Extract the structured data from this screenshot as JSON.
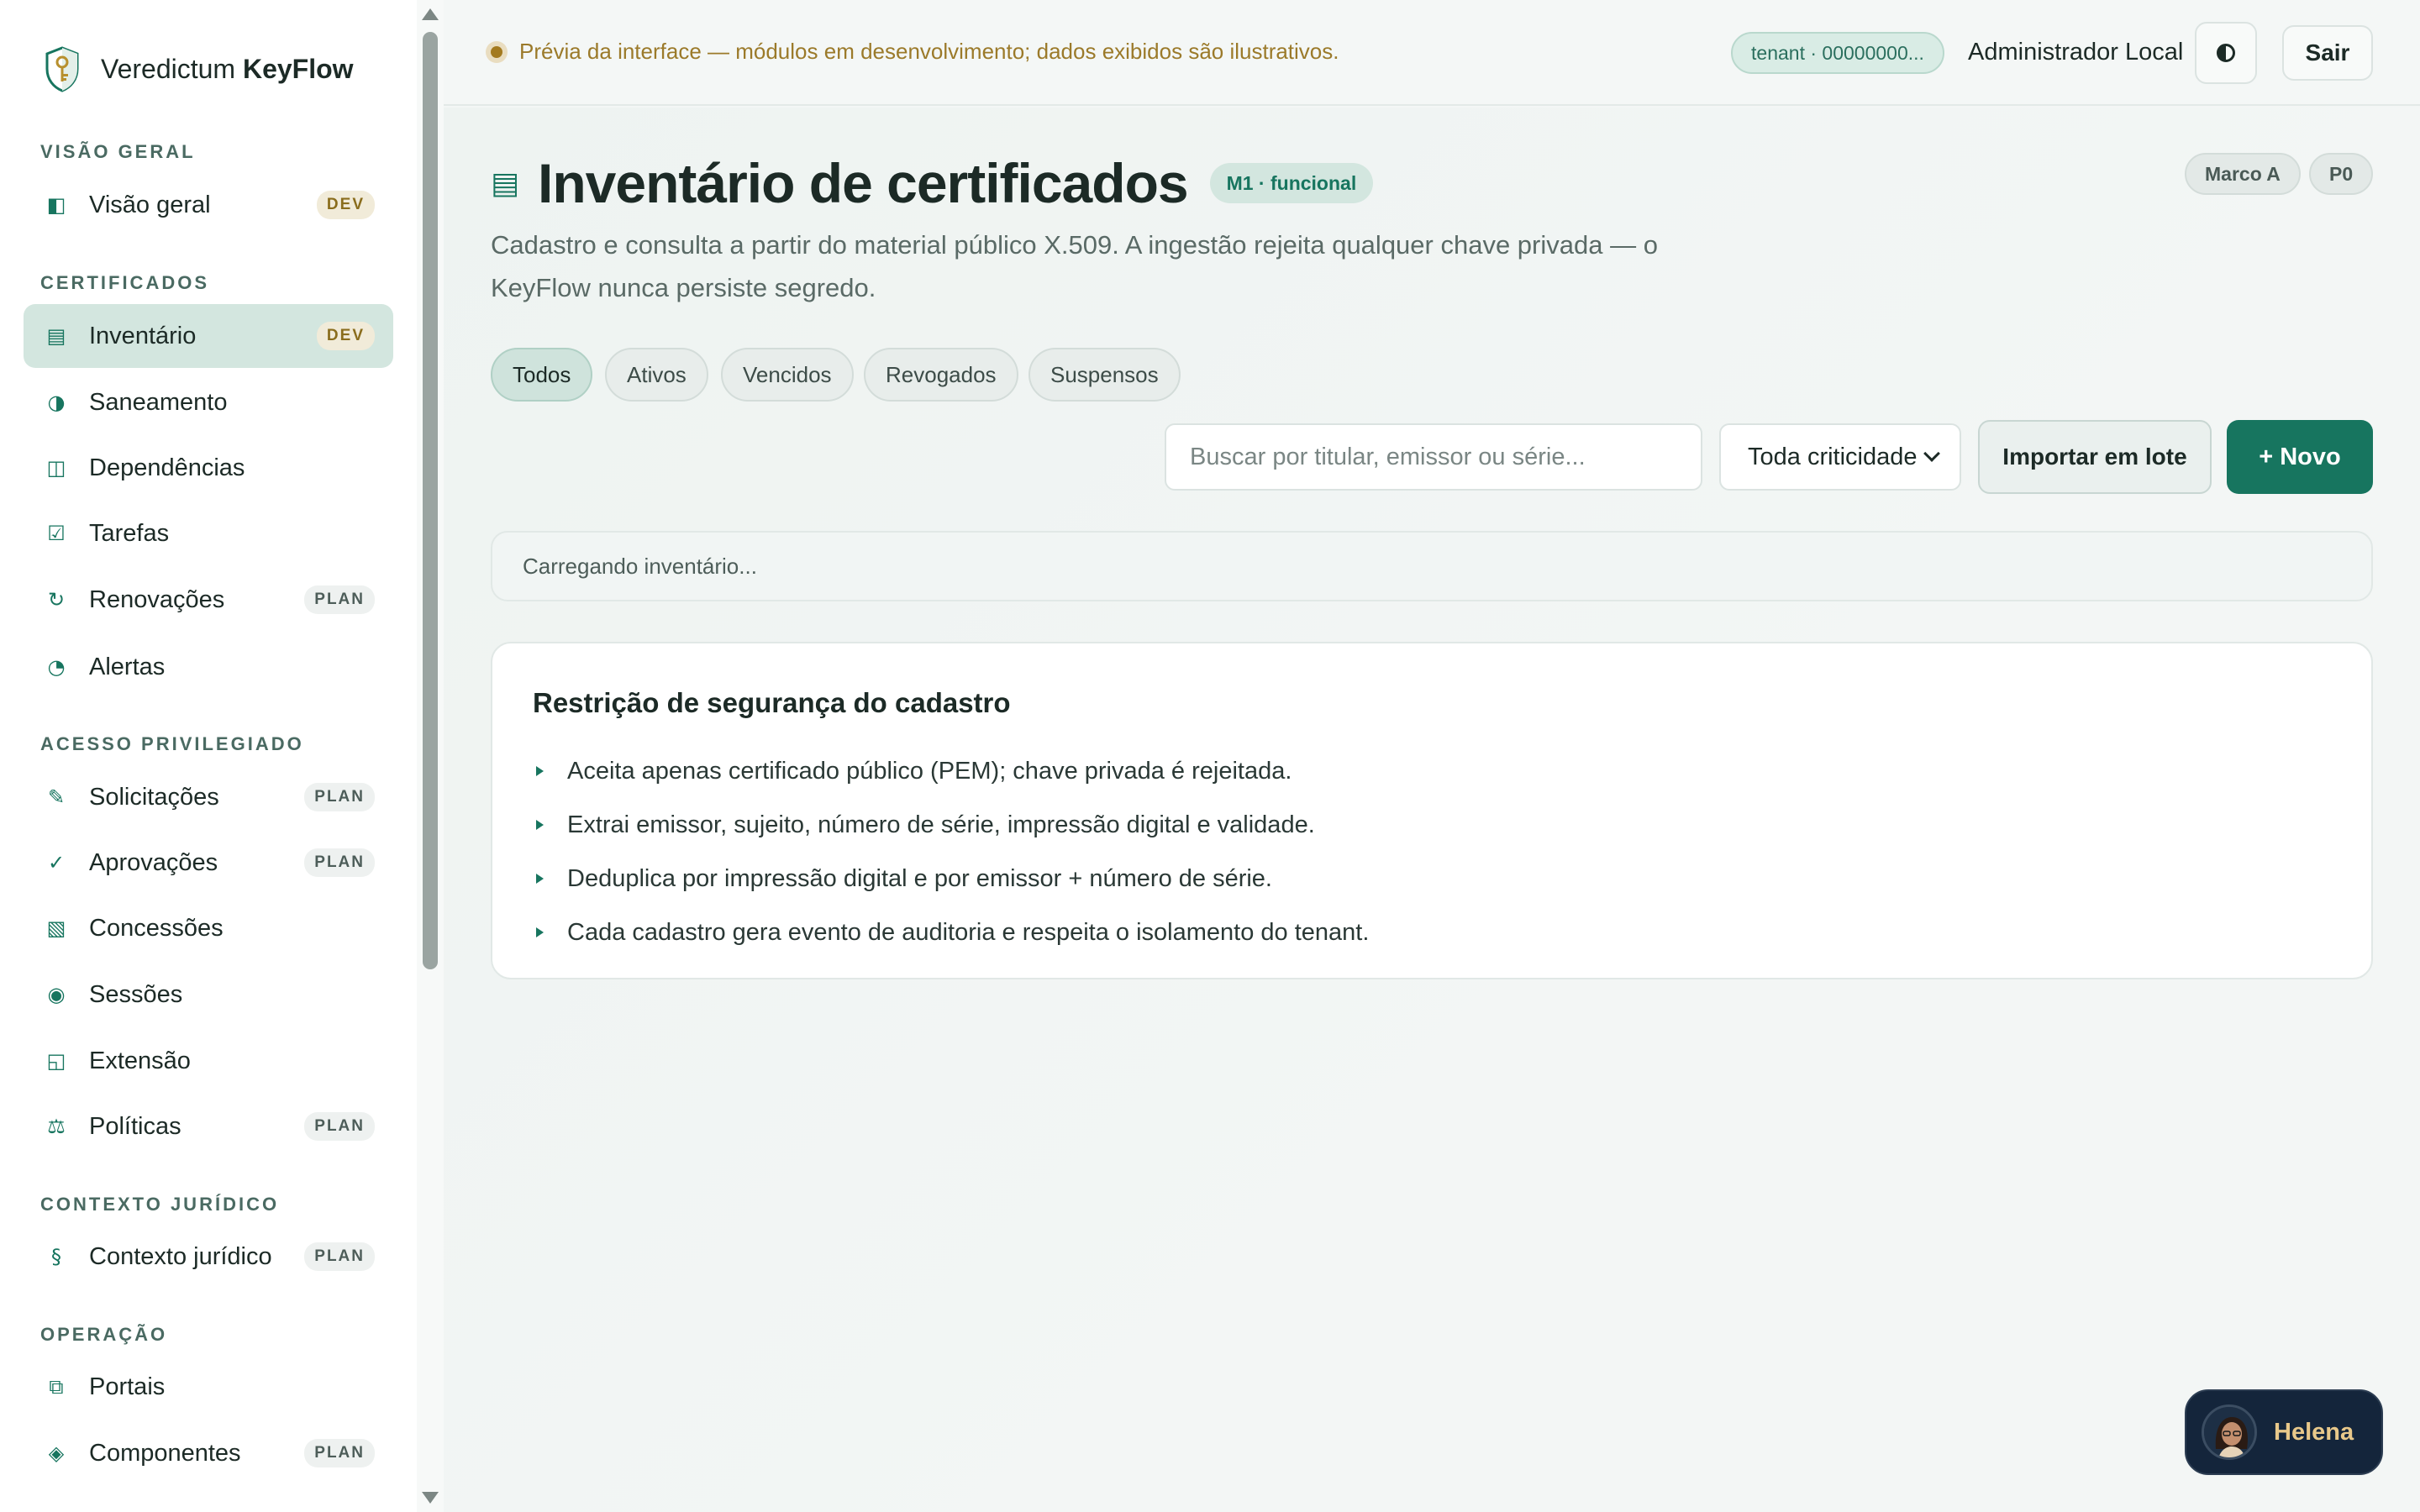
{
  "app": {
    "brand_prefix": "Veredictum",
    "brand_name": "KeyFlow"
  },
  "sidebar": {
    "sections": [
      {
        "title": "VISÃO GERAL",
        "items": [
          {
            "label": "Visão geral",
            "icon": "overview-icon",
            "badge": "DEV"
          }
        ]
      },
      {
        "title": "CERTIFICADOS",
        "items": [
          {
            "label": "Inventário",
            "icon": "list-icon",
            "badge": "DEV",
            "active": true
          },
          {
            "label": "Saneamento",
            "icon": "half-circle-icon",
            "badge": ""
          },
          {
            "label": "Dependências",
            "icon": "columns-icon",
            "badge": ""
          },
          {
            "label": "Tarefas",
            "icon": "checkbox-icon",
            "badge": ""
          },
          {
            "label": "Renovações",
            "icon": "refresh-icon",
            "badge": "PLAN"
          },
          {
            "label": "Alertas",
            "icon": "pie-icon",
            "badge": ""
          }
        ]
      },
      {
        "title": "ACESSO PRIVILEGIADO",
        "items": [
          {
            "label": "Solicitações",
            "icon": "pen-icon",
            "badge": "PLAN"
          },
          {
            "label": "Aprovações",
            "icon": "check-icon",
            "badge": "PLAN"
          },
          {
            "label": "Concessões",
            "icon": "document-icon",
            "badge": ""
          },
          {
            "label": "Sessões",
            "icon": "record-icon",
            "badge": ""
          },
          {
            "label": "Extensão",
            "icon": "extension-icon",
            "badge": ""
          },
          {
            "label": "Políticas",
            "icon": "scales-icon",
            "badge": "PLAN"
          }
        ]
      },
      {
        "title": "CONTEXTO JURÍDICO",
        "items": [
          {
            "label": "Contexto jurídico",
            "icon": "section-icon",
            "badge": "PLAN"
          }
        ]
      },
      {
        "title": "OPERAÇÃO",
        "items": [
          {
            "label": "Portais",
            "icon": "windows-icon",
            "badge": ""
          },
          {
            "label": "Componentes",
            "icon": "diamond-icon",
            "badge": "PLAN"
          }
        ]
      }
    ]
  },
  "topbar": {
    "notice": "Prévia da interface — módulos em desenvolvimento; dados exibidos são ilustrativos.",
    "tenant": "tenant · 00000000...",
    "user": "Administrador Local",
    "logout_label": "Sair"
  },
  "page": {
    "title": "Inventário de certificados",
    "status_chip": "M1 · funcional",
    "meta_chips": [
      "Marco A",
      "P0"
    ],
    "subtitle_line1": "Cadastro e consulta a partir do material público X.509. A ingestão rejeita qualquer chave privada — o",
    "subtitle_line2": "KeyFlow nunca persiste segredo."
  },
  "filters": {
    "tabs": [
      "Todos",
      "Ativos",
      "Vencidos",
      "Revogados",
      "Suspensos"
    ],
    "active": "Todos"
  },
  "toolbar": {
    "search_placeholder": "Buscar por titular, emissor ou série...",
    "criticality_value": "Toda criticidade",
    "import_label": "Importar em lote",
    "new_label": "+ Novo"
  },
  "loading_text": "Carregando inventário...",
  "security_card": {
    "title": "Restrição de segurança do cadastro",
    "items": [
      "Aceita apenas certificado público (PEM); chave privada é rejeitada.",
      "Extrai emissor, sujeito, número de série, impressão digital e validade.",
      "Deduplica por impressão digital e por emissor + número de série.",
      "Cada cadastro gera evento de auditoria e respeita o isolamento do tenant."
    ]
  },
  "assistant": {
    "name": "Helena"
  },
  "colors": {
    "accent": "#17755f",
    "accent_light": "#d3e6df",
    "notice": "#9b7a2a",
    "assistant_bg": "#14253b"
  }
}
